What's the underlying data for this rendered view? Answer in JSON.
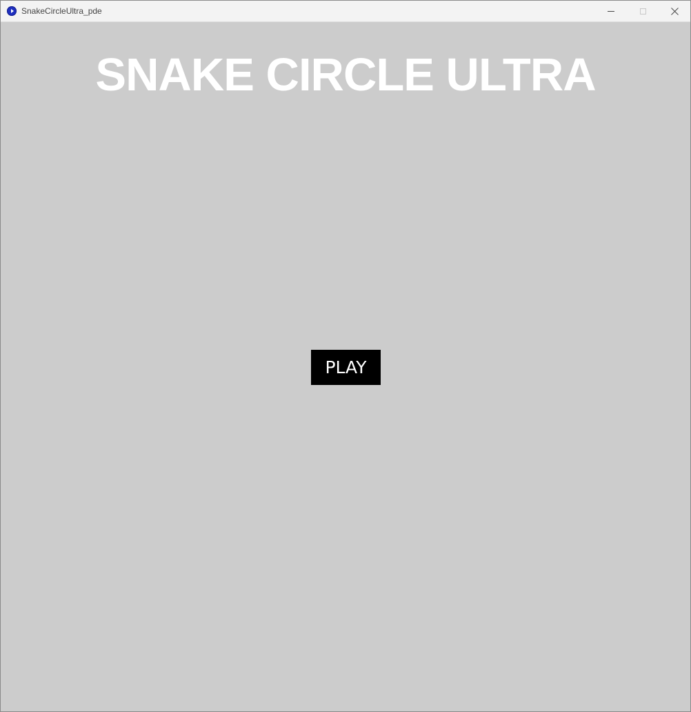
{
  "window": {
    "title": "SnakeCircleUltra_pde",
    "app_icon": "processing-app-icon",
    "controls": [
      "minimize-icon",
      "maximize-icon",
      "close-icon"
    ]
  },
  "game": {
    "title": "SNAKE CIRCLE ULTRA",
    "play_label": "PLAY"
  },
  "colors": {
    "background": "#cccccc",
    "title_text": "#ffffff",
    "button_bg": "#000000",
    "button_text": "#ffffff"
  }
}
